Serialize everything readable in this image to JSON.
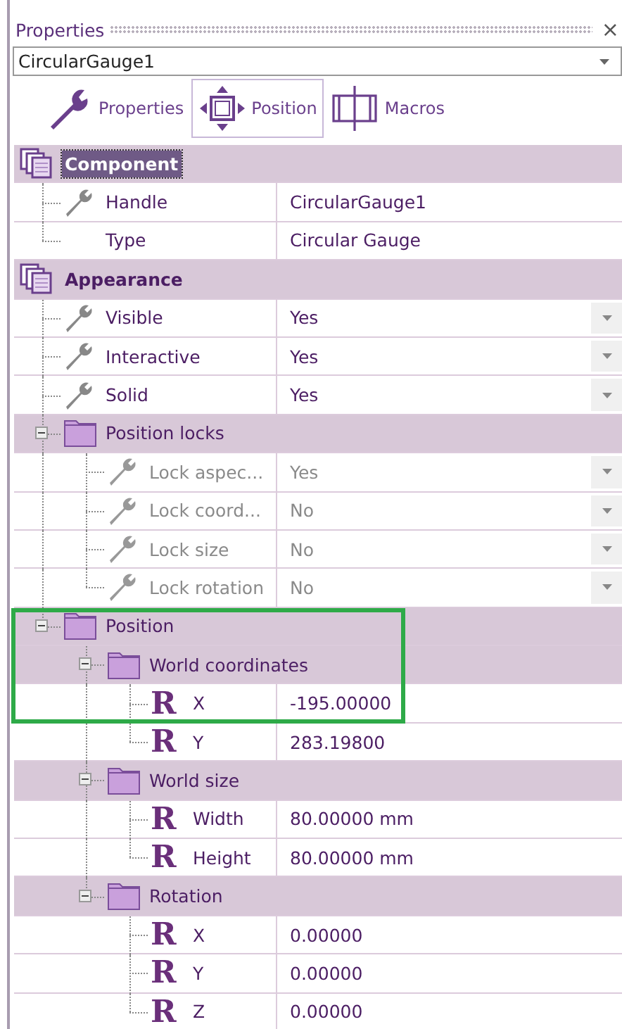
{
  "panel": {
    "title": "Properties",
    "close": "×"
  },
  "object_select": {
    "value": "CircularGauge1"
  },
  "tabs": [
    {
      "label": "Properties",
      "selected": false
    },
    {
      "label": "Position",
      "selected": true
    },
    {
      "label": "Macros",
      "selected": false
    }
  ],
  "tree": [
    {
      "kind": "category",
      "label": "Component",
      "selected": true,
      "highlighted": false,
      "children": [
        {
          "kind": "option",
          "label": "Handle",
          "value": "CircularGauge1",
          "dropdown": false,
          "disabled": false,
          "highlighted": false
        },
        {
          "kind": "plain",
          "label": "Type",
          "value": "Circular Gauge",
          "dropdown": false,
          "disabled": false,
          "highlighted": false
        }
      ]
    },
    {
      "kind": "category",
      "label": "Appearance",
      "selected": false,
      "highlighted": false,
      "children": [
        {
          "kind": "option",
          "label": "Visible",
          "value": "Yes",
          "dropdown": true,
          "disabled": false,
          "highlighted": false
        },
        {
          "kind": "option",
          "label": "Interactive",
          "value": "Yes",
          "dropdown": true,
          "disabled": false,
          "highlighted": false
        },
        {
          "kind": "option",
          "label": "Solid",
          "value": "Yes",
          "dropdown": true,
          "disabled": false,
          "highlighted": false
        },
        {
          "kind": "group",
          "label": "Position locks",
          "expanded": true,
          "highlighted": false,
          "children": [
            {
              "kind": "option",
              "label": "Lock aspec...",
              "value": "Yes",
              "dropdown": true,
              "disabled": true,
              "highlighted": false
            },
            {
              "kind": "option",
              "label": "Lock coord...",
              "value": "No",
              "dropdown": true,
              "disabled": true,
              "highlighted": false
            },
            {
              "kind": "option",
              "label": "Lock size",
              "value": "No",
              "dropdown": true,
              "disabled": true,
              "highlighted": false
            },
            {
              "kind": "option",
              "label": "Lock rotation",
              "value": "No",
              "dropdown": true,
              "disabled": true,
              "highlighted": false
            }
          ]
        },
        {
          "kind": "group",
          "label": "Position",
          "expanded": true,
          "highlighted": true,
          "children": [
            {
              "kind": "group",
              "label": "World coordinates",
              "expanded": true,
              "highlighted": true,
              "children": [
                {
                  "kind": "real",
                  "glyph": "R",
                  "label": "X",
                  "value": "-195.00000",
                  "dropdown": false,
                  "disabled": false,
                  "highlighted": true
                },
                {
                  "kind": "real",
                  "glyph": "R",
                  "label": "Y",
                  "value": "283.19800",
                  "dropdown": false,
                  "disabled": false,
                  "highlighted": false
                }
              ]
            },
            {
              "kind": "group",
              "label": "World size",
              "expanded": true,
              "highlighted": false,
              "children": [
                {
                  "kind": "real",
                  "glyph": "R",
                  "label": "Width",
                  "value": "80.00000 mm",
                  "dropdown": false,
                  "disabled": false,
                  "highlighted": false
                },
                {
                  "kind": "real",
                  "glyph": "R",
                  "label": "Height",
                  "value": "80.00000 mm",
                  "dropdown": false,
                  "disabled": false,
                  "highlighted": false
                }
              ]
            },
            {
              "kind": "group",
              "label": "Rotation",
              "expanded": true,
              "highlighted": false,
              "children": [
                {
                  "kind": "real",
                  "glyph": "R",
                  "label": "X",
                  "value": "0.00000",
                  "dropdown": false,
                  "disabled": false,
                  "highlighted": false
                },
                {
                  "kind": "real",
                  "glyph": "R",
                  "label": "Y",
                  "value": "0.00000",
                  "dropdown": false,
                  "disabled": false,
                  "highlighted": false
                },
                {
                  "kind": "real",
                  "glyph": "R",
                  "label": "Z",
                  "value": "0.00000",
                  "dropdown": false,
                  "disabled": false,
                  "highlighted": false
                }
              ]
            }
          ]
        }
      ]
    }
  ]
}
